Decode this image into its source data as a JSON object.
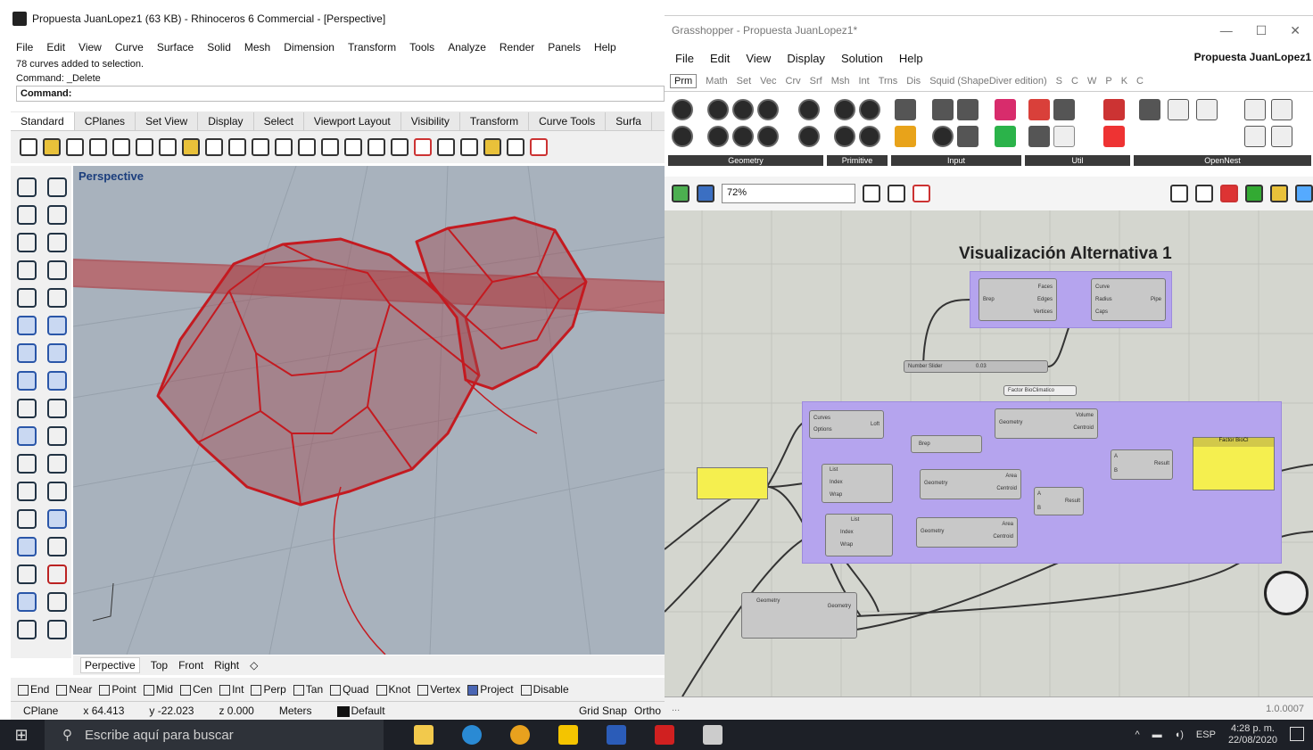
{
  "rhino": {
    "title": "Propuesta JuanLopez1 (63 KB) - Rhinoceros 6 Commercial - [Perspective]",
    "menu": [
      "File",
      "Edit",
      "View",
      "Curve",
      "Surface",
      "Solid",
      "Mesh",
      "Dimension",
      "Transform",
      "Tools",
      "Analyze",
      "Render",
      "Panels",
      "Help"
    ],
    "history": [
      "78 curves added to selection.",
      "Command: _Delete"
    ],
    "command_label": "Command:",
    "toolbar_tabs": [
      "Standard",
      "CPlanes",
      "Set View",
      "Display",
      "Select",
      "Viewport Layout",
      "Visibility",
      "Transform",
      "Curve Tools",
      "Surfa"
    ],
    "viewport_label": "Perspective",
    "viewport_tabs": [
      "Perpective",
      "Top",
      "Front",
      "Right"
    ],
    "osnaps": [
      {
        "label": "End",
        "on": false
      },
      {
        "label": "Near",
        "on": false
      },
      {
        "label": "Point",
        "on": false
      },
      {
        "label": "Mid",
        "on": false
      },
      {
        "label": "Cen",
        "on": false
      },
      {
        "label": "Int",
        "on": false
      },
      {
        "label": "Perp",
        "on": false
      },
      {
        "label": "Tan",
        "on": false
      },
      {
        "label": "Quad",
        "on": false
      },
      {
        "label": "Knot",
        "on": false
      },
      {
        "label": "Vertex",
        "on": false
      },
      {
        "label": "Project",
        "on": true
      },
      {
        "label": "Disable",
        "on": false
      }
    ],
    "status": {
      "cplane": "CPlane",
      "x": "x 64.413",
      "y": "y -22.023",
      "z": "z 0.000",
      "units": "Meters",
      "layer": "Default",
      "grid_snap": "Grid Snap",
      "ortho": "Ortho"
    }
  },
  "grasshopper": {
    "title": "Grasshopper - Propuesta JuanLopez1*",
    "menu": [
      "File",
      "Edit",
      "View",
      "Display",
      "Solution",
      "Help"
    ],
    "doc_name": "Propuesta JuanLopez1",
    "tabs": [
      "Prm",
      "Math",
      "Set",
      "Vec",
      "Crv",
      "Srf",
      "Msh",
      "Int",
      "Trns",
      "Dis",
      "Squid (ShapeDiver edition)",
      "S",
      "C",
      "W",
      "P",
      "K",
      "C"
    ],
    "ribbon_groups": [
      "Geometry",
      "Primitive",
      "Input",
      "Util",
      "OpenNest"
    ],
    "zoom": "72%",
    "canvas_title": "Visualización Alternativa 1",
    "slider_label": "Number Slider",
    "slider_value": "0.03",
    "panel_label": "Factor BioClimatico",
    "yellow_panel_title": "Factor BioCl",
    "node_labels": {
      "brep": "Brep",
      "faces": "Faces",
      "edges": "Edges",
      "vertices": "Vertices",
      "curve": "Curve",
      "radius": "Radius",
      "caps": "Caps",
      "pipe": "Pipe",
      "curves": "Curves",
      "options": "Options",
      "loft": "Loft",
      "geometry": "Geometry",
      "volume": "Volume",
      "centroid": "Centroid",
      "list": "List",
      "index": "Index",
      "wrap": "Wrap",
      "area": "Area",
      "result": "Result",
      "a": "A",
      "b": "B"
    },
    "version": "1.0.0007"
  },
  "taskbar": {
    "search_placeholder": "Escribe aquí para buscar",
    "time": "4:28 p. m.",
    "date": "22/08/2020",
    "lang": "ESP"
  },
  "icons": [
    "windows-icon",
    "search-icon",
    "file-explorer-icon",
    "edge-icon",
    "chrome-icon",
    "sticky-notes-icon",
    "word-icon",
    "app-icon",
    "rhino-icon"
  ]
}
